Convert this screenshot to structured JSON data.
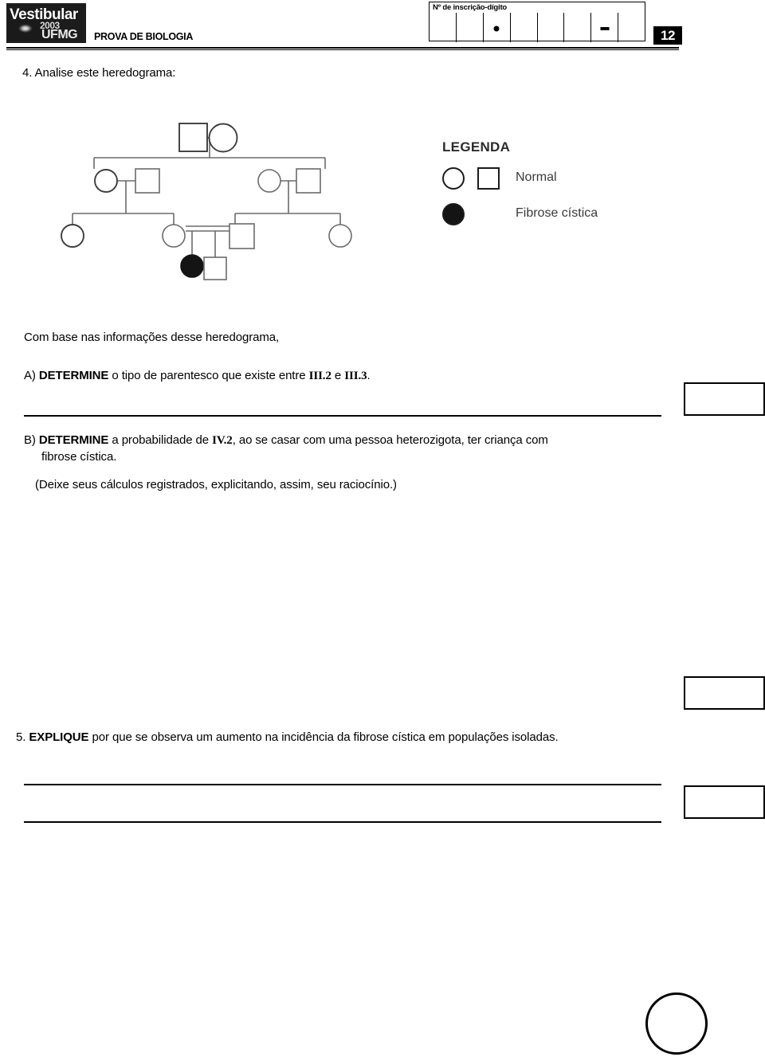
{
  "header": {
    "logo": {
      "word": "Vestibular",
      "year": "2003",
      "institution": "UFMG"
    },
    "exam_title": "PROVA DE BIOLOGIA",
    "inscription_label": "Nº de inscrição-dígito",
    "inscription_cells": [
      "",
      "",
      "•",
      "",
      "",
      "",
      "–",
      ""
    ],
    "page_number": "12"
  },
  "questions": {
    "q4_stem": "4. Analise este heredograma:",
    "com_base": "Com base nas informações desse heredograma,",
    "qA": {
      "prefix": "A) ",
      "verb": "DETERMINE",
      "text": " o tipo de parentesco que existe entre ",
      "ref1": "III.2",
      "conj": " e ",
      "ref2": "III.3",
      "end": "."
    },
    "qB": {
      "prefix": "B) ",
      "verb": "DETERMINE",
      "text1": " a probabilidade de ",
      "ref1": "IV.2",
      "text2": ", ao se casar com uma pessoa heterozigota, ter criança com",
      "text3": "fibrose cística.",
      "note": "(Deixe seus cálculos registrados, explicitando, assim, seu raciocínio.)"
    },
    "q5": {
      "prefix": "5. ",
      "verb": "EXPLIQUE",
      "text": " por que se observa um aumento na incidência da fibrose cística em populações isoladas."
    }
  },
  "legend": {
    "title": "LEGENDA",
    "normal_label": "Normal",
    "affected_label": "Fibrose cística"
  },
  "pedigree": {
    "type": "pedigree-chart",
    "generations": [
      {
        "id": "I",
        "individuals": [
          {
            "id": "I.1",
            "sex": "male",
            "shape": "square",
            "affected": false
          },
          {
            "id": "I.2",
            "sex": "female",
            "shape": "circle",
            "affected": false
          }
        ]
      },
      {
        "id": "II",
        "individuals": [
          {
            "id": "II.spouse-left",
            "sex": "female",
            "shape": "circle",
            "affected": false
          },
          {
            "id": "II.1",
            "sex": "male",
            "shape": "square",
            "affected": false
          },
          {
            "id": "II.2",
            "sex": "female",
            "shape": "circle",
            "affected": false
          },
          {
            "id": "II.spouse-right",
            "sex": "male",
            "shape": "square",
            "affected": false
          }
        ]
      },
      {
        "id": "III",
        "individuals": [
          {
            "id": "III.1",
            "sex": "female",
            "shape": "circle",
            "affected": false
          },
          {
            "id": "III.2",
            "sex": "female",
            "shape": "circle",
            "affected": false
          },
          {
            "id": "III.3",
            "sex": "male",
            "shape": "square",
            "affected": false
          },
          {
            "id": "III.4",
            "sex": "female",
            "shape": "circle",
            "affected": false
          }
        ]
      },
      {
        "id": "IV",
        "individuals": [
          {
            "id": "IV.1",
            "sex": "female",
            "shape": "circle",
            "affected": true
          },
          {
            "id": "IV.2",
            "sex": "male",
            "shape": "square",
            "affected": false
          }
        ]
      }
    ],
    "consanguineous_union": [
      "III.2",
      "III.3"
    ],
    "affected_individuals": [
      "IV.1"
    ]
  },
  "colors": {
    "ink": "#000000",
    "diagram_line": "#6b6b6b",
    "diagram_stroke": "#555555",
    "affected_fill": "#141414",
    "legend_text": "#3a3a3a",
    "paper": "#ffffff"
  },
  "answer_lines": {
    "count": 5
  },
  "score_boxes": {
    "count": 3
  }
}
